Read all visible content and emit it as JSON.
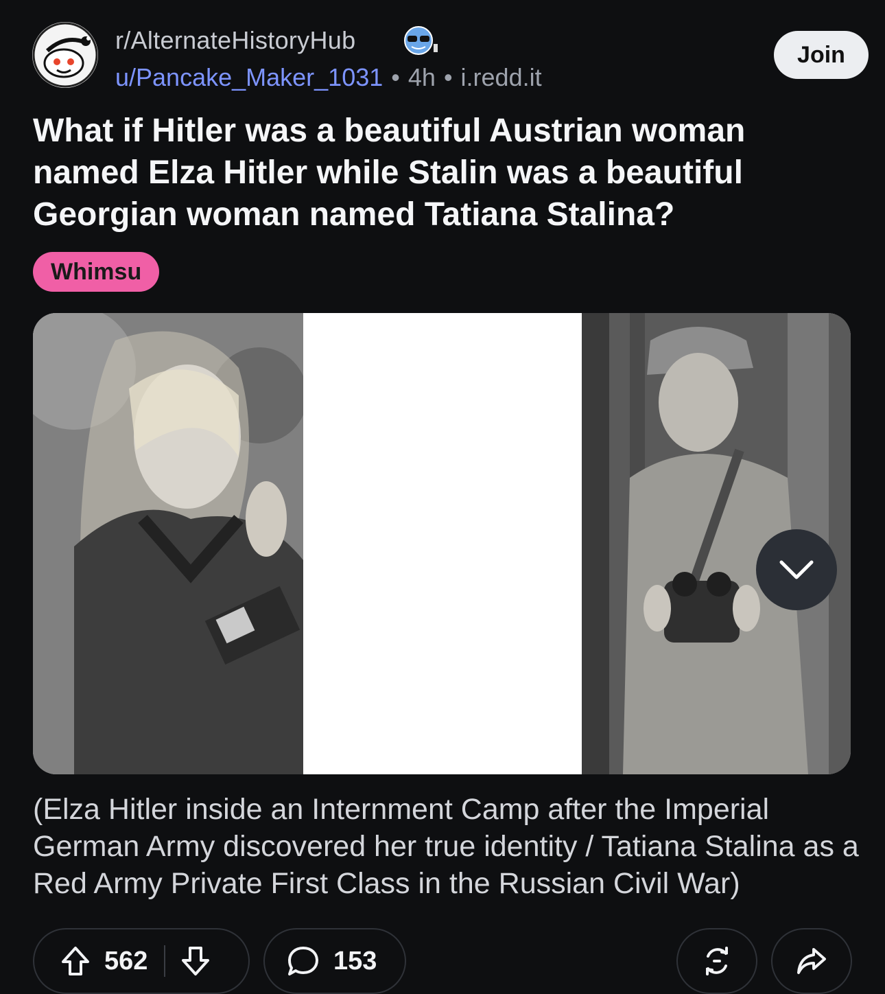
{
  "post": {
    "subreddit": "r/AlternateHistoryHub",
    "user": "u/Pancake_Maker_1031",
    "age": "4h",
    "domain": "i.redd.it",
    "sep": "•",
    "join_label": "Join",
    "title": "What if Hitler was a beautiful Austrian woman named Elza Hitler while Stalin was a beautiful Georgian woman named Tatiana Stalina?",
    "flair": "Whimsu",
    "caption": "(Elza Hitler inside an Internment Camp after the Imperial German Army discovered her true identity / Tatiana Stalina as a Red Army Private First Class in the Russian Civil War)",
    "upvotes": "562",
    "comments": "153"
  },
  "colors": {
    "background": "#0e0f11",
    "username": "#7d94ff",
    "flair": "#f05fa6",
    "join_button": "#eceef1"
  },
  "icons": [
    "snoo-avatar-icon",
    "subreddit-badge-icon",
    "chevron-down-icon",
    "upvote-icon",
    "downvote-icon",
    "comment-icon",
    "award-icon",
    "share-icon"
  ]
}
